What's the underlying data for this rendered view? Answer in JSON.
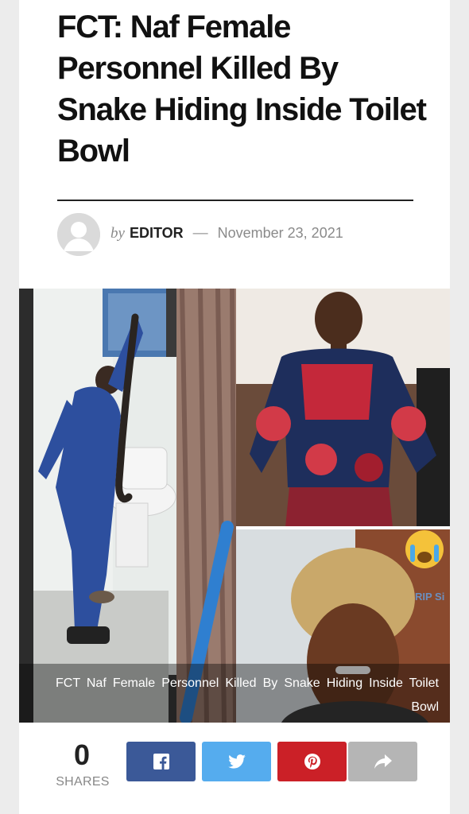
{
  "article": {
    "title": "FCT: Naf Female Personnel Killed By Snake Hiding Inside Toilet Bowl",
    "byline": {
      "by": "by",
      "author": "EDITOR",
      "separator": "—",
      "date": "November 23, 2021"
    },
    "image": {
      "caption": "FCT Naf Female Personnel Killed By Snake Hiding Inside Toilet Bowl",
      "overlay_text": "RIP Si"
    }
  },
  "share": {
    "count": "0",
    "label": "SHARES",
    "buttons": [
      {
        "network": "facebook",
        "icon": "facebook-icon",
        "color": "#3b5998"
      },
      {
        "network": "twitter",
        "icon": "twitter-icon",
        "color": "#55acee"
      },
      {
        "network": "pinterest",
        "icon": "pinterest-icon",
        "color": "#cb2027"
      },
      {
        "network": "more",
        "icon": "share-arrow-icon",
        "color": "#b5b5b5"
      }
    ]
  }
}
